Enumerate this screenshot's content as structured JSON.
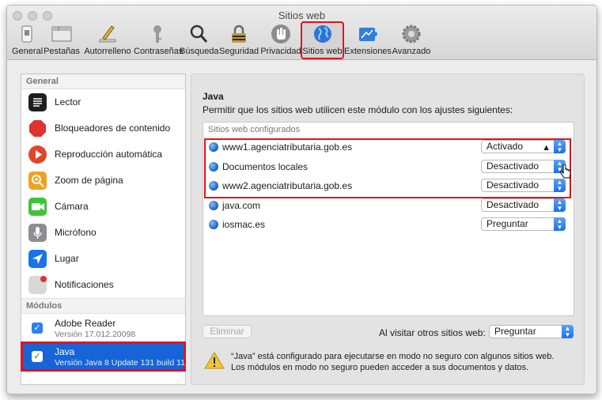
{
  "window": {
    "title": "Sitios web"
  },
  "toolbar": [
    {
      "label": "General",
      "icon": "switch-icon"
    },
    {
      "label": "Pestañas",
      "icon": "tabs-icon"
    },
    {
      "label": "Autorrelleno",
      "icon": "pencil-icon"
    },
    {
      "label": "Contraseñas",
      "icon": "key-icon"
    },
    {
      "label": "Búsqueda",
      "icon": "magnifier-icon"
    },
    {
      "label": "Seguridad",
      "icon": "lock-icon"
    },
    {
      "label": "Privacidad",
      "icon": "hand-icon"
    },
    {
      "label": "Sitios web",
      "icon": "globe-icon",
      "selected": true
    },
    {
      "label": "Extensiones",
      "icon": "puzzle-icon"
    },
    {
      "label": "Avanzado",
      "icon": "gear-icon"
    }
  ],
  "sidebar": {
    "general_header": "General",
    "general_items": [
      {
        "label": "Lector",
        "icon": "reader-icon",
        "color": "#1f1f1f"
      },
      {
        "label": "Bloqueadores de contenido",
        "icon": "stop-sign-icon",
        "color": "#e0322f"
      },
      {
        "label": "Reproducción automática",
        "icon": "play-icon",
        "color": "#e2452d"
      },
      {
        "label": "Zoom de página",
        "icon": "zoom-icon",
        "color": "#f0a21c"
      },
      {
        "label": "Cámara",
        "icon": "camera-icon",
        "color": "#3ec43c"
      },
      {
        "label": "Micrófono",
        "icon": "microphone-icon",
        "color": "#8d8d93"
      },
      {
        "label": "Lugar",
        "icon": "location-icon",
        "color": "#1a73e8"
      },
      {
        "label": "Notificaciones",
        "icon": "notifications-icon",
        "color": "#d8d8d8"
      }
    ],
    "modules_header": "Módulos",
    "modules": [
      {
        "name": "Adobe Reader",
        "version": "Versión 17.012.20098",
        "checked": true
      },
      {
        "name": "Java",
        "version": "Versión Java 8 Update 131 build 11",
        "checked": true,
        "selected": true
      }
    ]
  },
  "main": {
    "heading": "Java",
    "description": "Permitir que los sitios web utilicen este módulo con los ajustes siguientes:",
    "configured_header": "Sitios web configurados",
    "sites": [
      {
        "name": "www1.agenciatributaria.gob.es",
        "setting": "Activado",
        "warning": true
      },
      {
        "name": "Documentos locales",
        "setting": "Desactivado"
      },
      {
        "name": "www2.agenciatributaria.gob.es",
        "setting": "Desactivado"
      },
      {
        "name": "java.com",
        "setting": "Desactivado"
      },
      {
        "name": "iosmac.es",
        "setting": "Preguntar"
      }
    ],
    "remove_button": "Eliminar",
    "visit_label": "Al visitar otros sitios web:",
    "visit_value": "Preguntar",
    "warning_text": "“Java” está configurado para ejecutarse en modo no seguro con algunos sitios web. Los módulos en modo no seguro pueden acceder a sus documentos y datos."
  },
  "colors": {
    "accent": "#1764d6",
    "highlight": "#e0141e"
  }
}
